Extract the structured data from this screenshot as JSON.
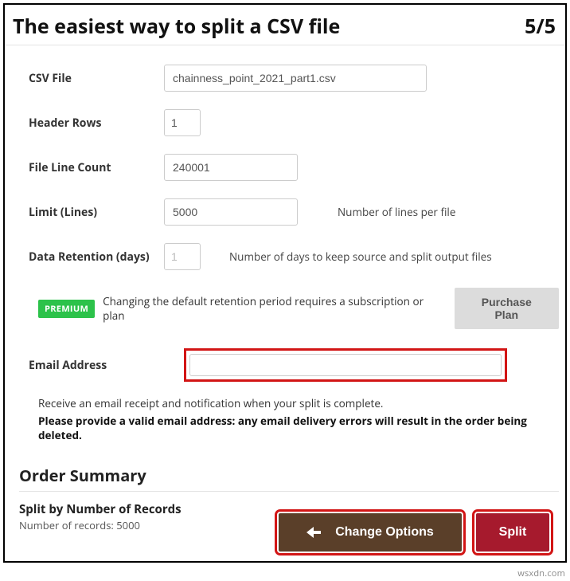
{
  "header": {
    "title": "The easiest way to split a CSV file",
    "step": "5/5"
  },
  "form": {
    "csv_file": {
      "label": "CSV File",
      "value": "chainness_point_2021_part1.csv"
    },
    "header_rows": {
      "label": "Header Rows",
      "value": "1"
    },
    "file_line_count": {
      "label": "File Line Count",
      "value": "240001"
    },
    "limit": {
      "label": "Limit (Lines)",
      "value": "5000",
      "hint": "Number of lines per file"
    },
    "retention": {
      "label": "Data Retention (days)",
      "value": "1",
      "hint": "Number of days to keep source and split output files"
    },
    "premium": {
      "badge": "PREMIUM",
      "text": "Changing the default retention period requires a subscription or plan",
      "button": "Purchase Plan"
    },
    "email": {
      "label": "Email Address",
      "value": ""
    },
    "notes": {
      "line1": "Receive an email receipt and notification when your split is complete.",
      "line2": "Please provide a valid email address: any email delivery errors will result in the order being deleted."
    }
  },
  "summary": {
    "header": "Order Summary",
    "title": "Split by Number of Records",
    "sub": "Number of records: 5000"
  },
  "buttons": {
    "change": "Change Options",
    "split": "Split"
  },
  "watermark": "wsxdn.com"
}
